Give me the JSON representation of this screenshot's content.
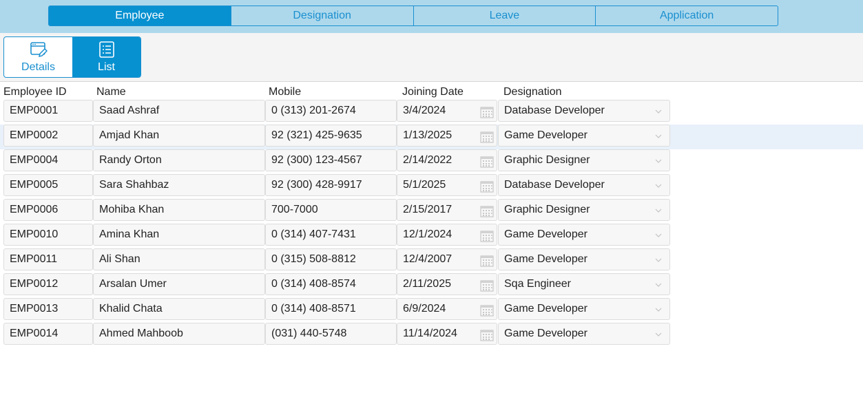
{
  "tabs": [
    {
      "label": "Employee",
      "active": true
    },
    {
      "label": "Designation",
      "active": false
    },
    {
      "label": "Leave",
      "active": false
    },
    {
      "label": "Application",
      "active": false
    }
  ],
  "view_toggle": {
    "details_label": "Details",
    "list_label": "List",
    "details_icon": "edit-window-icon",
    "list_icon": "list-icon",
    "selected": "List"
  },
  "columns": {
    "id": "Employee ID",
    "name": "Name",
    "mobile": "Mobile",
    "joining": "Joining Date",
    "designation": "Designation"
  },
  "rows": [
    {
      "id": "EMP0001",
      "name": "Saad Ashraf",
      "mobile": "0 (313) 201-2674",
      "joining": "3/4/2024",
      "designation": "Database Developer"
    },
    {
      "id": "EMP0002",
      "name": "Amjad Khan",
      "mobile": "92 (321) 425-9635",
      "joining": "1/13/2025",
      "designation": "Game Developer"
    },
    {
      "id": "EMP0004",
      "name": "Randy Orton",
      "mobile": "92 (300) 123-4567",
      "joining": "2/14/2022",
      "designation": "Graphic Designer"
    },
    {
      "id": "EMP0005",
      "name": "Sara Shahbaz",
      "mobile": "92 (300) 428-9917",
      "joining": "5/1/2025",
      "designation": "Database Developer"
    },
    {
      "id": "EMP0006",
      "name": "Mohiba Khan",
      "mobile": "700-7000",
      "joining": "2/15/2017",
      "designation": "Graphic Designer"
    },
    {
      "id": "EMP0010",
      "name": "Amina Khan",
      "mobile": "0 (314) 407-7431",
      "joining": "12/1/2024",
      "designation": "Game Developer"
    },
    {
      "id": "EMP0011",
      "name": "Ali Shan",
      "mobile": "0 (315) 508-8812",
      "joining": "12/4/2007",
      "designation": "Game Developer"
    },
    {
      "id": "EMP0012",
      "name": "Arsalan Umer",
      "mobile": "0 (314) 408-8574",
      "joining": "2/11/2025",
      "designation": "Sqa Engineer"
    },
    {
      "id": "EMP0013",
      "name": "Khalid Chata",
      "mobile": "0 (314) 408-8571",
      "joining": "6/9/2024",
      "designation": "Game Developer"
    },
    {
      "id": "EMP0014",
      "name": "Ahmed Mahboob",
      "mobile": "(031) 440-5748",
      "joining": "11/14/2024",
      "designation": "Game Developer"
    }
  ],
  "highlighted_row": "EMP0002",
  "colors": {
    "accent": "#0891d1",
    "tab_band": "#add8ec",
    "row_highlight": "#e8f1fa"
  }
}
